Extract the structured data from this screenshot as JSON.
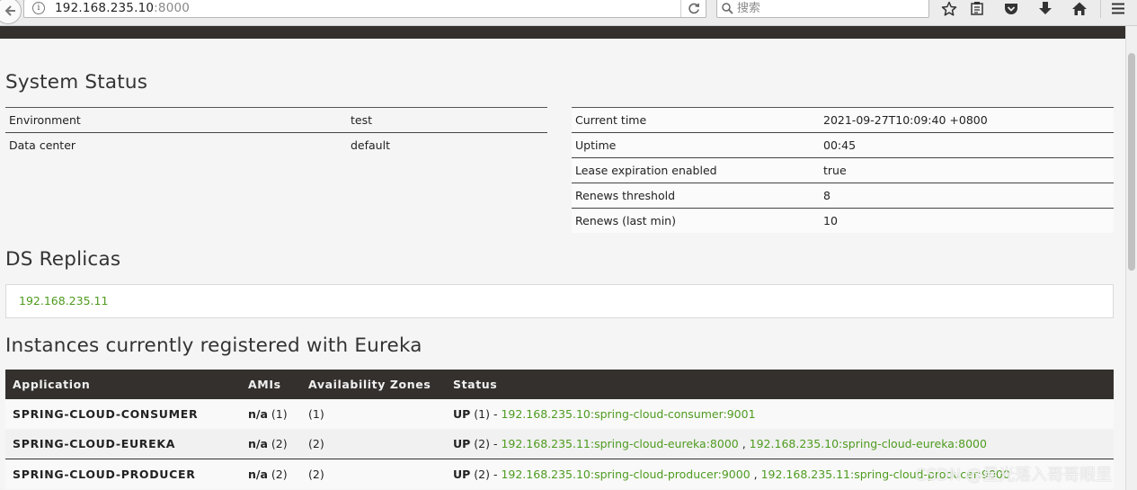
{
  "browser": {
    "url_host": "192.168.235.10",
    "url_port": ":8000",
    "search_placeholder": "搜索"
  },
  "system_status": {
    "title": "System Status",
    "left": [
      {
        "key": "Environment",
        "value": "test"
      },
      {
        "key": "Data center",
        "value": "default"
      }
    ],
    "right": [
      {
        "key": "Current time",
        "value": "2021-09-27T10:09:40 +0800"
      },
      {
        "key": "Uptime",
        "value": "00:45"
      },
      {
        "key": "Lease expiration enabled",
        "value": "true"
      },
      {
        "key": "Renews threshold",
        "value": "8"
      },
      {
        "key": "Renews (last min)",
        "value": "10"
      }
    ]
  },
  "ds_replicas": {
    "title": "DS Replicas",
    "items": [
      "192.168.235.11"
    ]
  },
  "instances": {
    "title": "Instances currently registered with Eureka",
    "headers": [
      "Application",
      "AMIs",
      "Availability Zones",
      "Status"
    ],
    "rows": [
      {
        "application": "SPRING-CLOUD-CONSUMER",
        "amis_na": "n/a",
        "amis_count": " (1)",
        "zones": "(1)",
        "status_up": "UP",
        "status_count": " (1) - ",
        "links": [
          "192.168.235.10:spring-cloud-consumer:9001"
        ]
      },
      {
        "application": "SPRING-CLOUD-EUREKA",
        "amis_na": "n/a",
        "amis_count": " (2)",
        "zones": "(2)",
        "status_up": "UP",
        "status_count": " (2) - ",
        "links": [
          "192.168.235.11:spring-cloud-eureka:8000",
          "192.168.235.10:spring-cloud-eureka:8000"
        ]
      },
      {
        "application": "SPRING-CLOUD-PRODUCER",
        "amis_na": "n/a",
        "amis_count": " (2)",
        "zones": "(2)",
        "status_up": "UP",
        "status_count": " (2) - ",
        "links": [
          "192.168.235.10:spring-cloud-producer:9000",
          "192.168.235.11:spring-cloud-producer:9000"
        ]
      }
    ],
    "link_separator": " , "
  },
  "watermark": "CSDN @星光落入哥哥眼里",
  "colors": {
    "header_dark": "#34302d",
    "link_green": "#4e9b1f",
    "page_bg": "#f5f5f5"
  }
}
